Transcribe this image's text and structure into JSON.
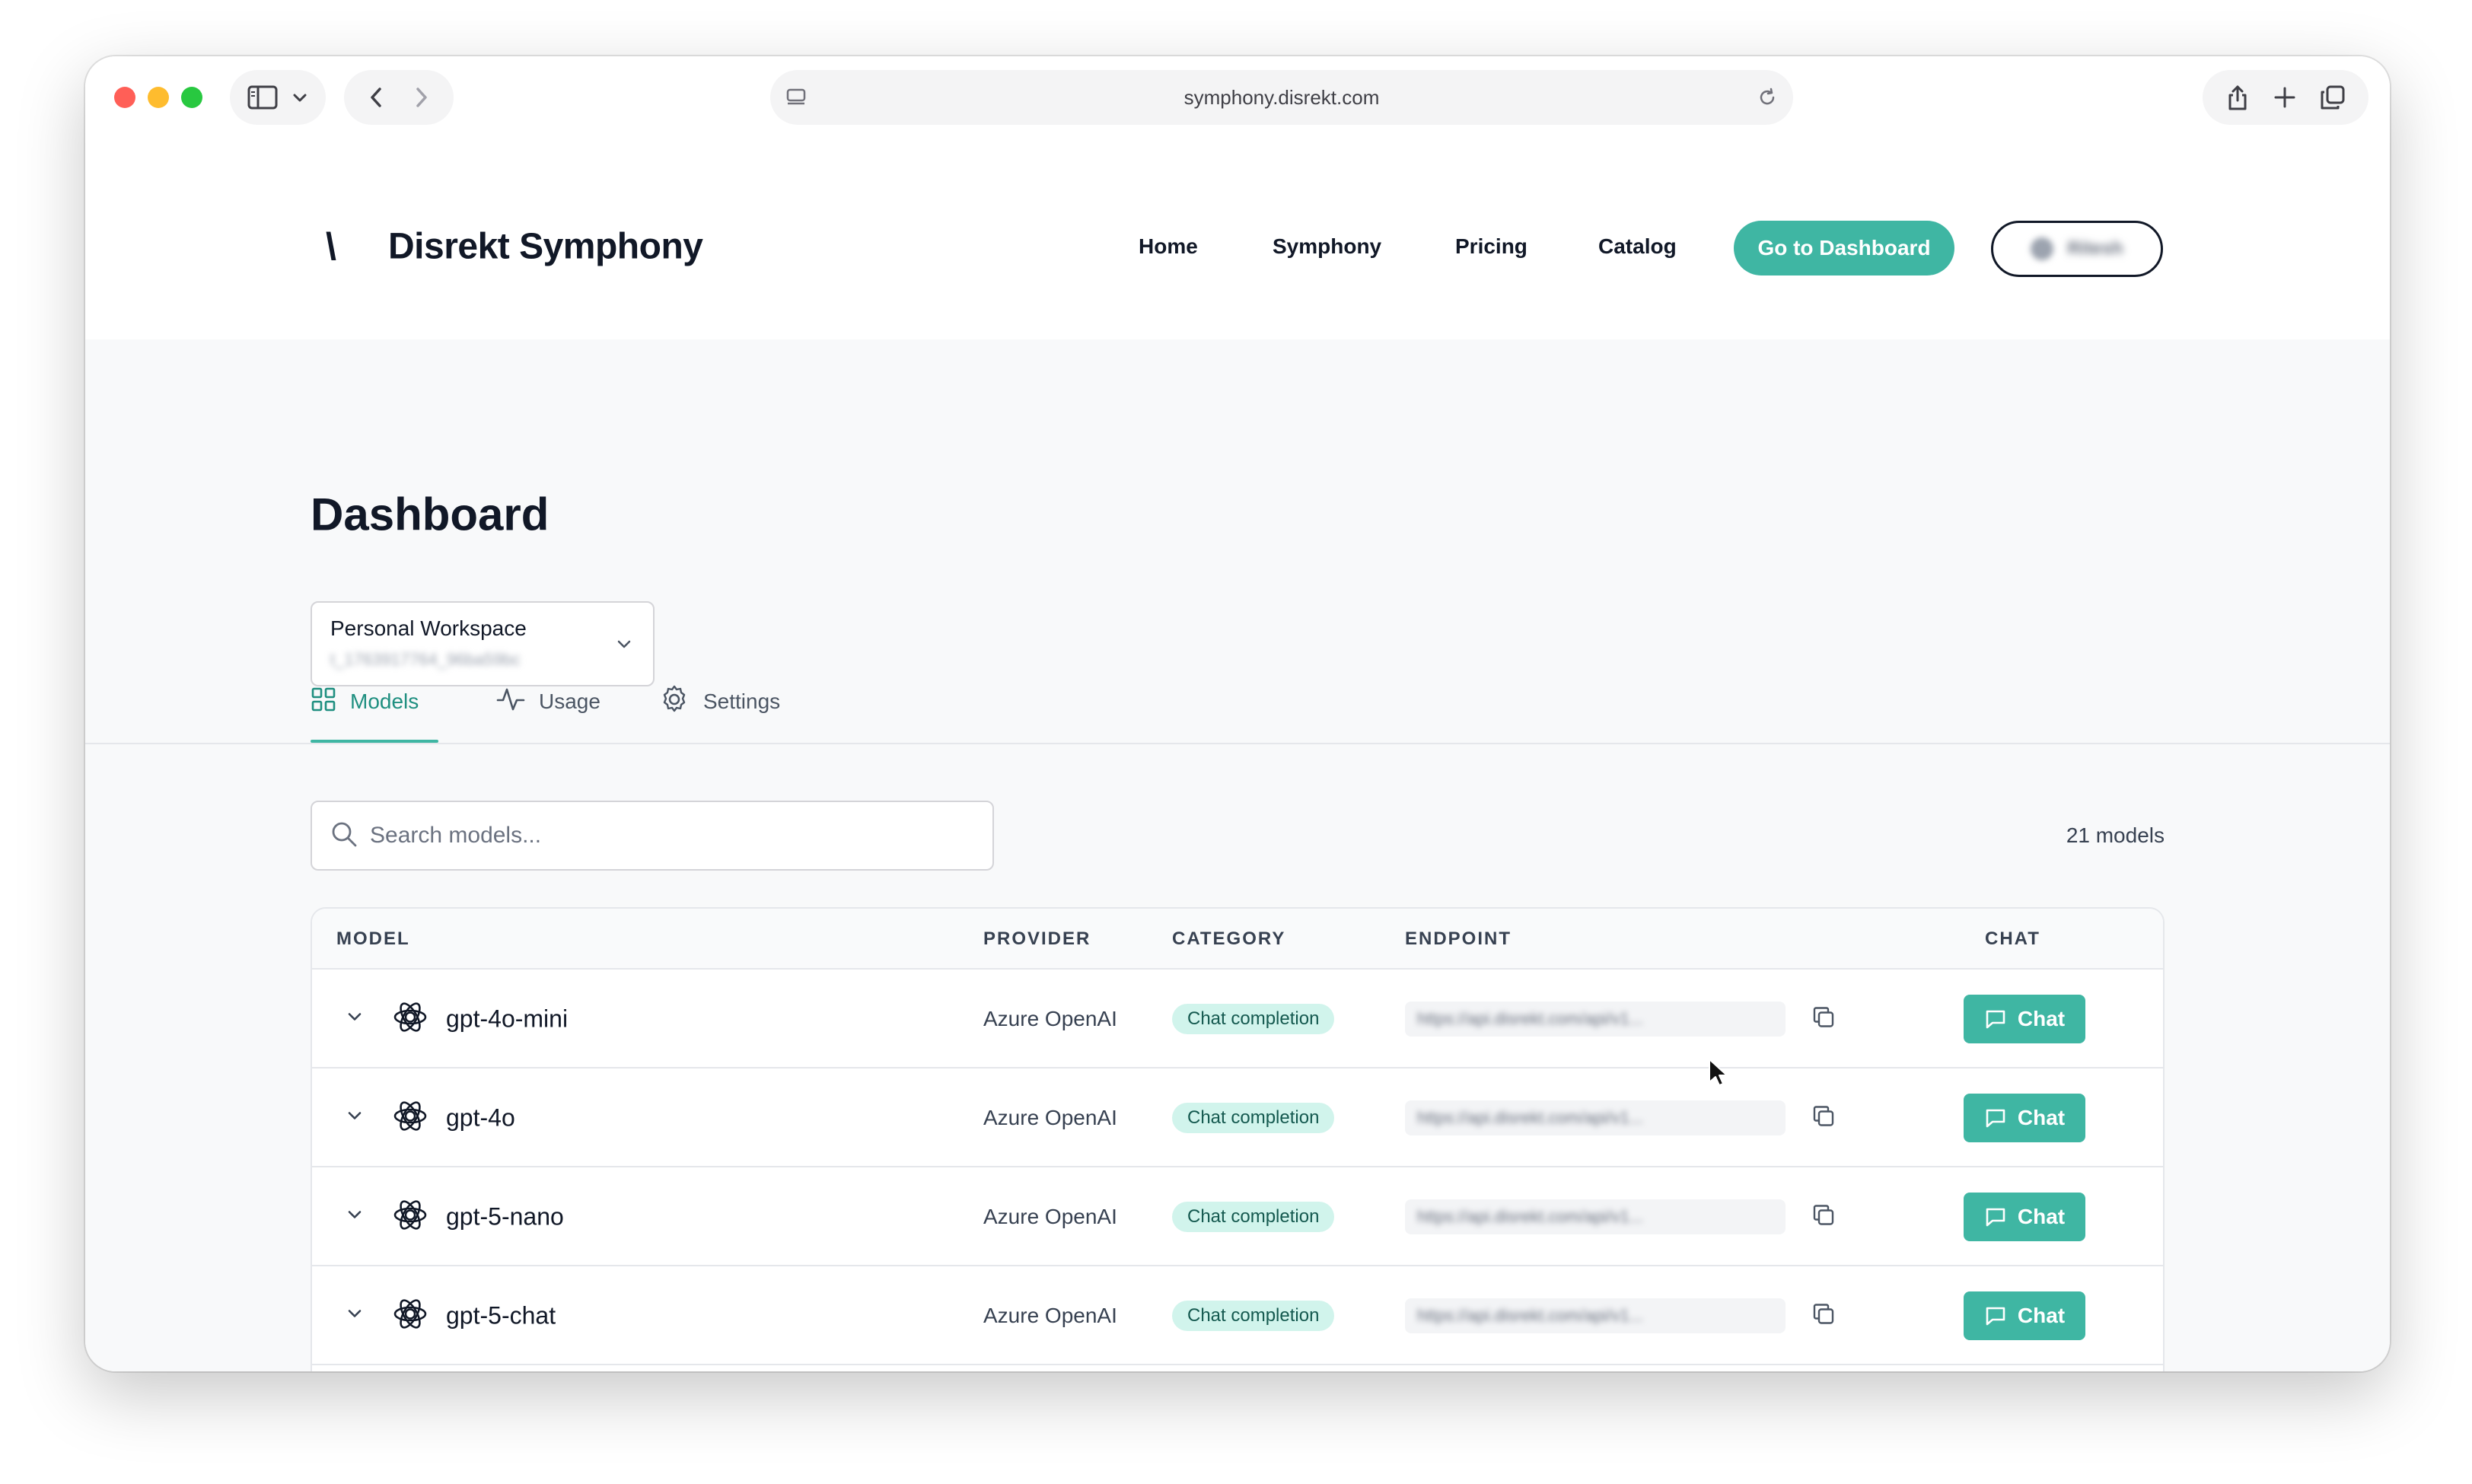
{
  "browser": {
    "url": "symphony.disrekt.com"
  },
  "header": {
    "logo_mark": "\\",
    "brand": "Disrekt Symphony",
    "nav": [
      {
        "label": "Home"
      },
      {
        "label": "Symphony"
      },
      {
        "label": "Pricing"
      },
      {
        "label": "Catalog"
      }
    ],
    "cta_label": "Go to Dashboard",
    "user_label": "Ritesh"
  },
  "page": {
    "title": "Dashboard",
    "workspace": {
      "name": "Personal Workspace",
      "id": "t_1763917764_96ba59bc"
    },
    "tabs": [
      {
        "label": "Models",
        "icon": "grid-icon",
        "active": true
      },
      {
        "label": "Usage",
        "icon": "activity-icon",
        "active": false
      },
      {
        "label": "Settings",
        "icon": "gear-icon",
        "active": false
      }
    ],
    "search_placeholder": "Search models...",
    "model_count": "21 models"
  },
  "table": {
    "headers": {
      "model": "MODEL",
      "provider": "PROVIDER",
      "category": "CATEGORY",
      "endpoint": "ENDPOINT",
      "chat": "CHAT"
    },
    "rows": [
      {
        "model": "gpt-4o-mini",
        "provider": "Azure OpenAI",
        "category": "Chat completion",
        "endpoint": "https://api.disrekt.com/api/v1...",
        "chat": "Chat"
      },
      {
        "model": "gpt-4o",
        "provider": "Azure OpenAI",
        "category": "Chat completion",
        "endpoint": "https://api.disrekt.com/api/v1...",
        "chat": "Chat"
      },
      {
        "model": "gpt-5-nano",
        "provider": "Azure OpenAI",
        "category": "Chat completion",
        "endpoint": "https://api.disrekt.com/api/v1...",
        "chat": "Chat"
      },
      {
        "model": "gpt-5-chat",
        "provider": "Azure OpenAI",
        "category": "Chat completion",
        "endpoint": "https://api.disrekt.com/api/v1...",
        "chat": "Chat"
      }
    ]
  },
  "colors": {
    "accent": "#3fb6a3",
    "badge_bg": "#d1f4ec",
    "badge_text": "#14594f"
  }
}
